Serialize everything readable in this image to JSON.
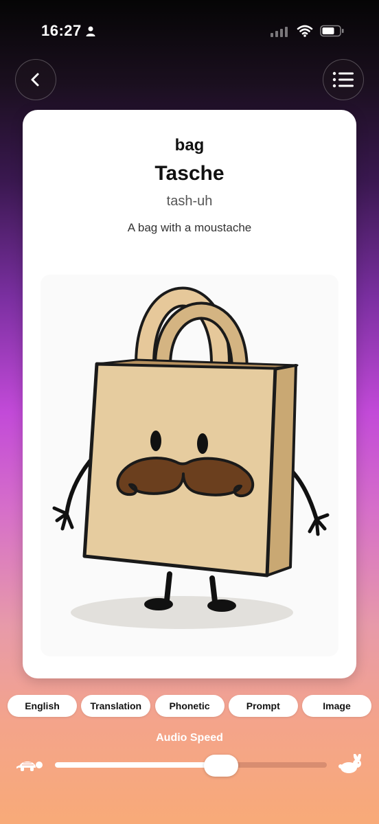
{
  "status_bar": {
    "time": "16:27"
  },
  "header": {
    "back_icon": "chevron-left-icon",
    "menu_icon": "list-icon"
  },
  "card": {
    "english": "bag",
    "translation": "Tasche",
    "phonetic": "tash-uh",
    "prompt": "A bag with a moustache"
  },
  "toggles": [
    "English",
    "Translation",
    "Phonetic",
    "Prompt",
    "Image"
  ],
  "audio": {
    "label": "Audio Speed",
    "level": 0.61,
    "slow_icon": "turtle-icon",
    "fast_icon": "rabbit-icon"
  },
  "colors": {
    "card": "#ffffff",
    "accent_purple": "#c24ad8",
    "accent_peach": "#f8aa78"
  }
}
